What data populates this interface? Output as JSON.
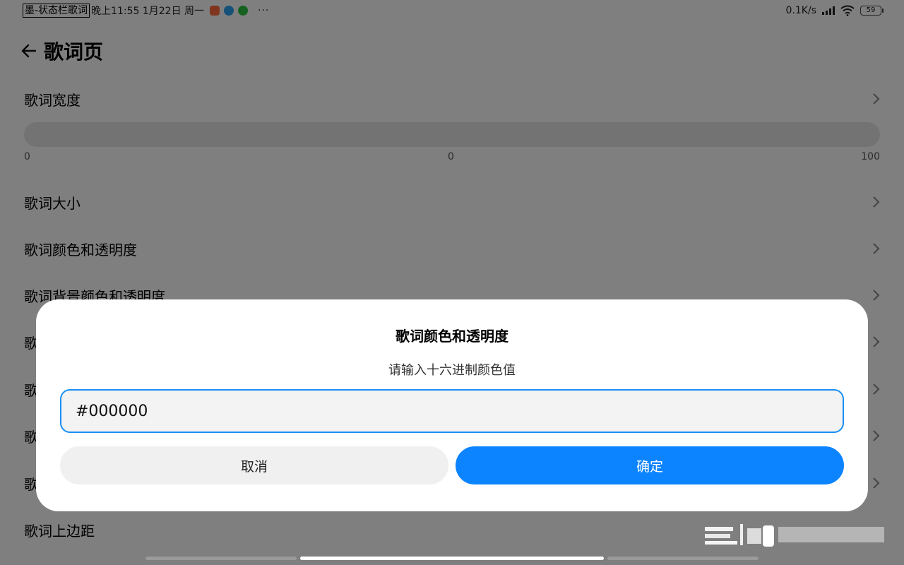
{
  "status_bar": {
    "lyric": "墨-状态栏歌词",
    "time": "晚上11:55 1月22日 周一",
    "more": "···",
    "net_speed": "0.1K/s",
    "battery": "59"
  },
  "header": {
    "title": "歌词页"
  },
  "settings": {
    "width_label": "歌词宽度",
    "slider": {
      "min": "0",
      "value": "0",
      "max": "100",
      "value_number": 0
    },
    "items": [
      "歌词大小",
      "歌词颜色和透明度",
      "歌词背景颜色和透明度",
      "歌",
      "歌",
      "歌",
      "歌",
      "歌词上边距"
    ]
  },
  "dialog": {
    "title": "歌词颜色和透明度",
    "message": "请输入十六进制颜色值",
    "input_value": "#000000",
    "cancel_label": "取消",
    "confirm_label": "确定"
  },
  "colors": {
    "accent": "#0d84ff",
    "input_border": "#1a8ff2",
    "scrim": "rgba(0,0,0,0.5)"
  }
}
